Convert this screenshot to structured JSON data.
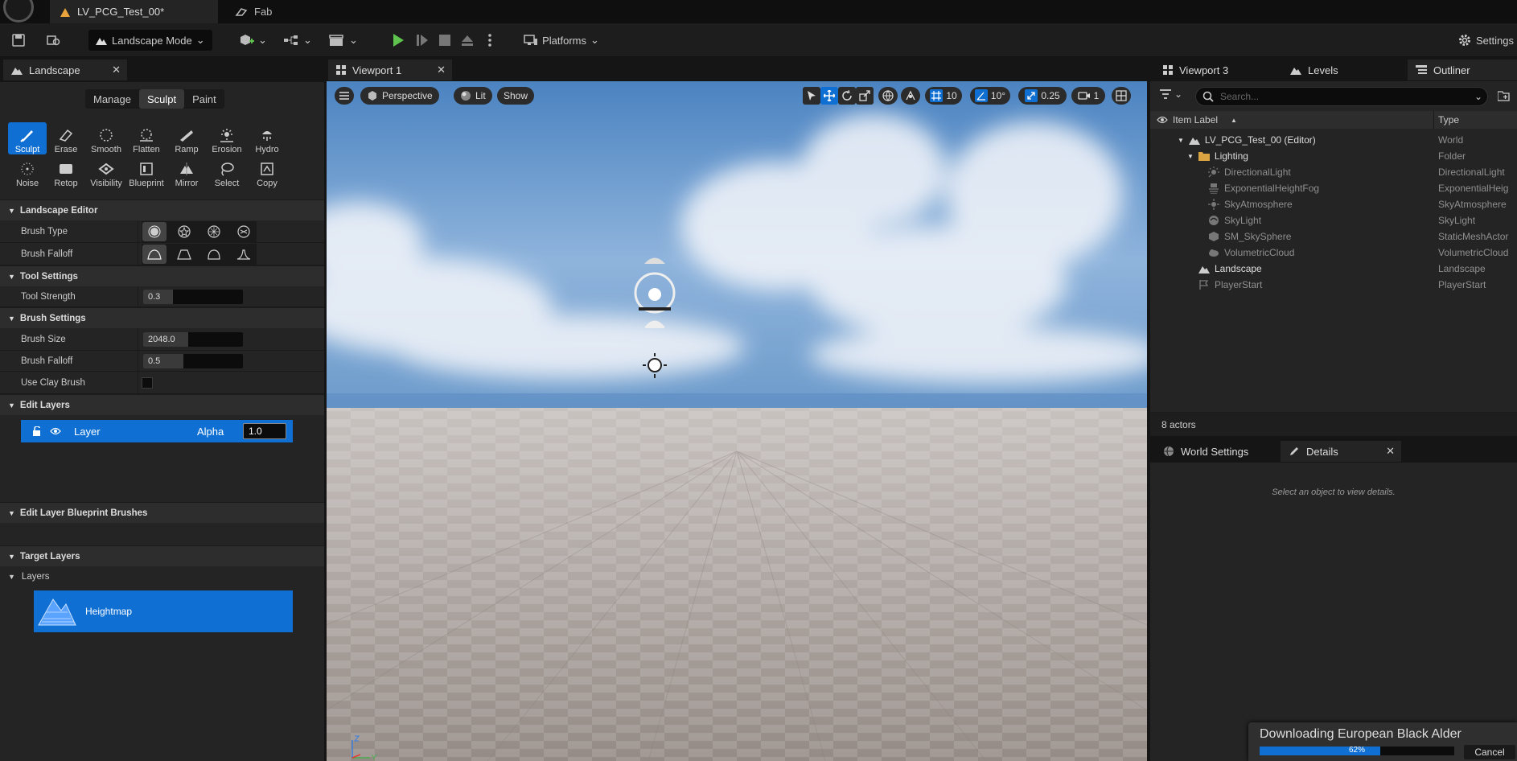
{
  "titlebar": {
    "level_tab": "LV_PCG_Test_00*",
    "fab_tab": "Fab"
  },
  "toolbar": {
    "mode": "Landscape Mode",
    "platforms": "Platforms",
    "settings": "Settings"
  },
  "landscape_panel": {
    "tab": "Landscape",
    "modes": [
      "Manage",
      "Sculpt",
      "Paint"
    ],
    "tools_row1": [
      "Sculpt",
      "Erase",
      "Smooth",
      "Flatten",
      "Ramp",
      "Erosion",
      "Hydro"
    ],
    "tools_row2": [
      "Noise",
      "Retop",
      "Visibility",
      "Blueprint",
      "Mirror",
      "Select",
      "Copy"
    ],
    "sections": {
      "landscape_editor": "Landscape Editor",
      "tool_settings": "Tool Settings",
      "brush_settings": "Brush Settings",
      "edit_layers": "Edit Layers",
      "edit_layer_bp": "Edit Layer Blueprint Brushes",
      "target_layers": "Target Layers"
    },
    "props": {
      "brush_type": "Brush Type",
      "brush_falloff_type": "Brush Falloff",
      "tool_strength": "Tool Strength",
      "tool_strength_value": "0.3",
      "tool_strength_level": 0.3,
      "brush_size": "Brush Size",
      "brush_size_value": "2048.0",
      "brush_size_level": 0.45,
      "brush_falloff": "Brush Falloff",
      "brush_falloff_value": "0.5",
      "brush_falloff_level": 0.4,
      "use_clay_brush": "Use Clay Brush"
    },
    "layer": {
      "name": "Layer",
      "alpha_label": "Alpha",
      "alpha_value": "1.0"
    },
    "layers_label": "Layers",
    "heightmap": "Heightmap"
  },
  "viewport": {
    "tab": "Viewport 1",
    "perspective": "Perspective",
    "lit": "Lit",
    "show": "Show",
    "grid_snap": "10",
    "rot_snap": "10°",
    "scale_snap": "0.25",
    "camera_speed": "1"
  },
  "outliner": {
    "tabs": [
      "Viewport 3",
      "Levels",
      "Outliner"
    ],
    "search_placeholder": "Search...",
    "col_label": "Item Label",
    "col_type": "Type",
    "items": [
      {
        "label": "LV_PCG_Test_00 (Editor)",
        "type": "World"
      },
      {
        "label": "Lighting",
        "type": "Folder"
      },
      {
        "label": "DirectionalLight",
        "type": "DirectionalLight"
      },
      {
        "label": "ExponentialHeightFog",
        "type": "ExponentialHeig"
      },
      {
        "label": "SkyAtmosphere",
        "type": "SkyAtmosphere"
      },
      {
        "label": "SkyLight",
        "type": "SkyLight"
      },
      {
        "label": "SM_SkySphere",
        "type": "StaticMeshActor"
      },
      {
        "label": "VolumetricCloud",
        "type": "VolumetricCloud"
      },
      {
        "label": "Landscape",
        "type": "Landscape"
      },
      {
        "label": "PlayerStart",
        "type": "PlayerStart"
      }
    ],
    "count": "8 actors"
  },
  "details": {
    "tabs": [
      "World Settings",
      "Details"
    ],
    "empty_text": "Select an object to view details."
  },
  "download": {
    "title": "Downloading European Black Alder",
    "progress_text": "62%",
    "progress": 0.62,
    "cancel": "Cancel"
  },
  "colors": {
    "accent": "#0f6fd3",
    "play_green": "#5ec44e",
    "panel": "#242424",
    "header": "#2d2d2d"
  }
}
